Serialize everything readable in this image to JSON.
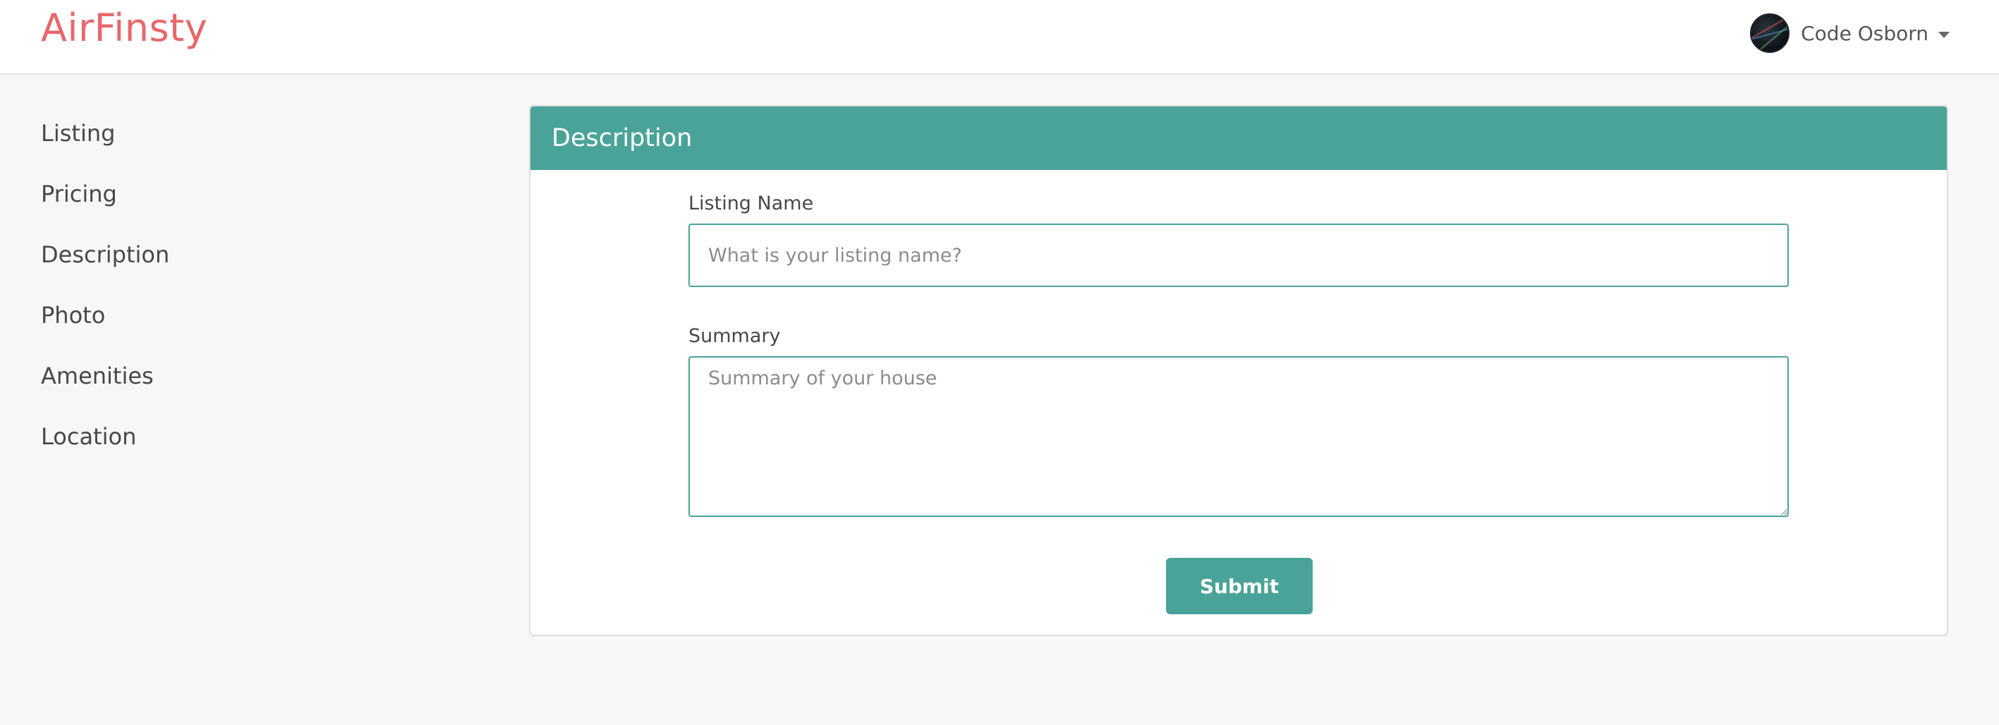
{
  "brand": {
    "name": "AirFinsty",
    "color": "#e8676b"
  },
  "user": {
    "name": "Code Osborn",
    "avatar_icon": "user-avatar",
    "menu_icon": "caret-down-icon"
  },
  "sidebar": {
    "items": [
      {
        "label": "Listing"
      },
      {
        "label": "Pricing"
      },
      {
        "label": "Description"
      },
      {
        "label": "Photo"
      },
      {
        "label": "Amenities"
      },
      {
        "label": "Location"
      }
    ]
  },
  "panel": {
    "title": "Description",
    "accent_color": "#4aa399"
  },
  "form": {
    "listing_name": {
      "label": "Listing Name",
      "placeholder": "What is your listing name?",
      "value": ""
    },
    "summary": {
      "label": "Summary",
      "placeholder": "Summary of your house",
      "value": ""
    },
    "submit_label": "Submit"
  }
}
